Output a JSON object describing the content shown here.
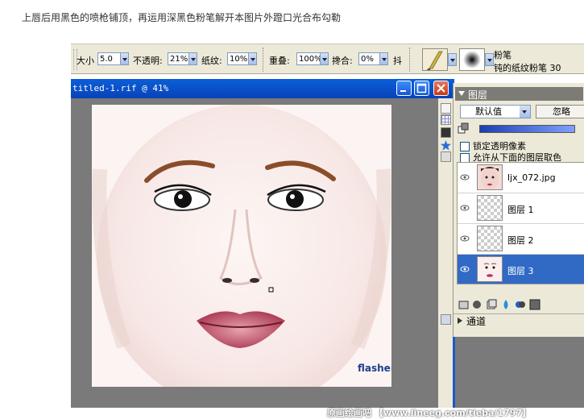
{
  "caption": "上唇后用黑色的喷枪铺顶，再运用深黑色粉笔解开本图片外蹬口光合布勾勒",
  "toolbar": {
    "size_label": "大小",
    "size_value": "5.0",
    "opacity_label": "不透明:",
    "opacity_value": "21%",
    "texture_label": "纸纹:",
    "texture_value": "10%",
    "overlap_label": "重叠:",
    "overlap_value": "100%",
    "blend_label": "搀合:",
    "blend_value": "0%",
    "shake_label": "抖",
    "brush_name": "粉笔",
    "brush_sub": "钝的纸纹粉笔",
    "brush_size": "30"
  },
  "document": {
    "title": "titled-1.rif @ 41%",
    "watermark": "flasher.cn",
    "credit": "原画绘画吧 【www.lineeg.com/tieba/1797】"
  },
  "layers_panel": {
    "title": "图层",
    "blend_mode": "默认值",
    "ignore_label": "忽略",
    "lock_label": "锁定透明像素",
    "pick_label": "允许从下面的图层取色",
    "layers": [
      {
        "name": "ljx_072.jpg",
        "selected": false
      },
      {
        "name": "图层 1",
        "selected": false
      },
      {
        "name": "图层 2",
        "selected": false
      },
      {
        "name": "图层 3",
        "selected": true
      }
    ],
    "channels_label": "通道"
  },
  "colors": {
    "titlebar": "#0a5fd8",
    "selection": "#316ac5",
    "panel_bg": "#ece9d8",
    "canvas_gray": "#7a7a7a"
  }
}
